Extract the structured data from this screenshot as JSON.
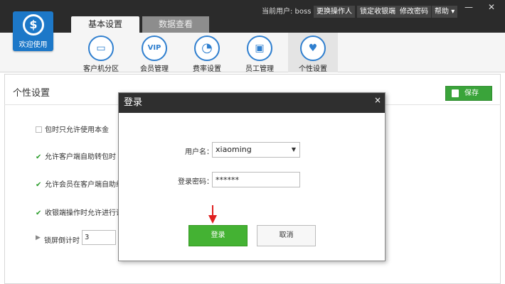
{
  "app": {
    "logo_text": "欢迎使用"
  },
  "header": {
    "current_user": "当前用户: boss",
    "buttons": [
      "更换操作人",
      "锁定收银端",
      "修改密码",
      "帮助"
    ],
    "window_controls": [
      "—",
      "✕"
    ]
  },
  "tabs": [
    {
      "label": "基本设置",
      "active": true
    },
    {
      "label": "数据查看",
      "active": false
    }
  ],
  "toolbar": {
    "items": [
      {
        "label": "客户机分区",
        "icon": "monitor-icon",
        "glyph": "▭"
      },
      {
        "label": "会员管理",
        "icon": "vip-icon",
        "glyph": "VIP"
      },
      {
        "label": "费率设置",
        "icon": "pie-chart-icon",
        "glyph": "◔"
      },
      {
        "label": "员工管理",
        "icon": "id-card-icon",
        "glyph": "▣"
      },
      {
        "label": "个性设置",
        "icon": "heart-gear-icon",
        "glyph": "♥",
        "active": true
      }
    ]
  },
  "page": {
    "title": "个性设置",
    "save_label": "保存",
    "options": [
      {
        "label": "包时只允许使用本金",
        "checked": false
      },
      {
        "label": "允许客户端自助转包时",
        "checked": true
      },
      {
        "label": "允许会员在客户端自助续",
        "checked": true
      },
      {
        "label": "收银端操作时允许进行语",
        "checked": true
      }
    ],
    "lock_label": "锁屏倒计时",
    "lock_value": "3"
  },
  "dialog": {
    "title": "登录",
    "close": "×",
    "username_label": "用户名：",
    "username_value": "xiaoming",
    "password_label": "登录密码：",
    "password_value": "******",
    "login_label": "登录",
    "cancel_label": "取消"
  },
  "colors": {
    "accent_blue": "#1d78c8",
    "green": "#44b233",
    "dark": "#2b2b2b",
    "arrow_red": "#e02020"
  }
}
